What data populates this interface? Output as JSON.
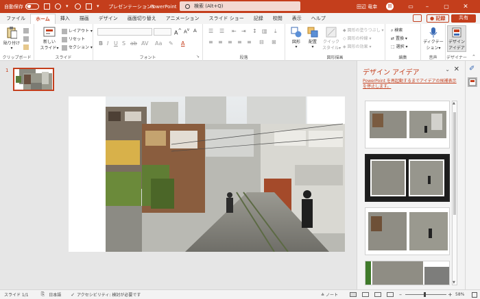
{
  "titlebar": {
    "autosave_label": "自動保存",
    "autosave_state": "オフ",
    "doc_title": "プレゼンテーション3",
    "app_name": "PowerPoint",
    "search_placeholder": "検索 (Alt+Q)",
    "user_name": "田辺 竜幸",
    "bg_color": "#c43e1c"
  },
  "tabs": [
    "ファイル",
    "ホーム",
    "挿入",
    "描画",
    "デザイン",
    "画面切り替え",
    "アニメーション",
    "スライド ショー",
    "記録",
    "校閲",
    "表示",
    "ヘルプ"
  ],
  "active_tab": "ホーム",
  "right_actions": {
    "record": "記録",
    "share": "共有"
  },
  "ribbon": {
    "clipboard": {
      "paste": "貼り付け",
      "label": "クリップボード"
    },
    "slides": {
      "new_slide": "新しい",
      "new_slide2": "スライド",
      "layout": "レイアウト",
      "reset": "リセット",
      "section": "セクション",
      "label": "スライド"
    },
    "font": {
      "label": "フォント"
    },
    "paragraph": {
      "label": "段落"
    },
    "drawing": {
      "shapes": "図形",
      "arrange": "配置",
      "quick_styles": "クイック",
      "quick_styles2": "スタイル",
      "fill": "図形の塗りつぶし",
      "outline": "図形の枠線",
      "effects": "図形の効果",
      "label": "図形描画"
    },
    "editing": {
      "find": "検索",
      "replace": "置換",
      "select": "選択",
      "label": "編集"
    },
    "voice": {
      "dictate": "ディクテー",
      "dictate2": "ション",
      "label": "音声"
    },
    "designer": {
      "ideas": "デザイン",
      "ideas2": "アイデア",
      "label": "デザイナー"
    }
  },
  "thumbnail": {
    "number": "1"
  },
  "design_panel": {
    "title": "デザイン アイデア",
    "notice": "PowerPoint を再起動するまでアイデアの候補表示を停止します。"
  },
  "statusbar": {
    "slide_info": "スライド 1/1",
    "language": "日本語",
    "accessibility": "アクセシビリティ: 検討が必要です",
    "notes": "ノート",
    "zoom": "58%"
  }
}
